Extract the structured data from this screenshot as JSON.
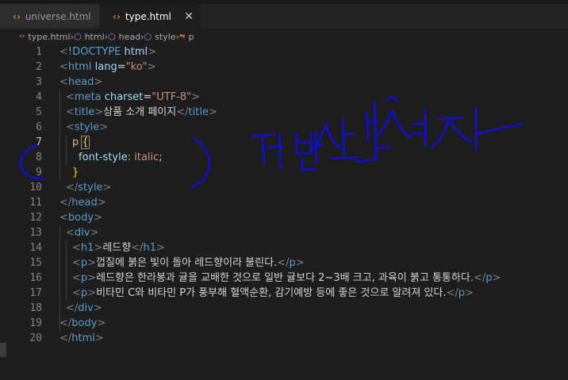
{
  "tabs": [
    {
      "label": "universe.html",
      "active": false
    },
    {
      "label": "type.html",
      "active": true
    }
  ],
  "breadcrumb": [
    "type.html",
    "html",
    "head",
    "style",
    "p"
  ],
  "lines": [
    {
      "n": "1",
      "tokens": [
        [
          "t-punct",
          "<"
        ],
        [
          "t-tag",
          "!DOCTYPE"
        ],
        [
          "t-text",
          " "
        ],
        [
          "t-attr",
          "html"
        ],
        [
          "t-punct",
          ">"
        ]
      ],
      "indent": 0
    },
    {
      "n": "2",
      "tokens": [
        [
          "t-punct",
          "<"
        ],
        [
          "t-tag",
          "html"
        ],
        [
          "t-text",
          " "
        ],
        [
          "t-attr",
          "lang"
        ],
        [
          "t-text",
          "="
        ],
        [
          "t-str",
          "\"ko\""
        ],
        [
          "t-punct",
          ">"
        ]
      ],
      "indent": 0
    },
    {
      "n": "3",
      "tokens": [
        [
          "t-punct",
          "<"
        ],
        [
          "t-tag",
          "head"
        ],
        [
          "t-punct",
          ">"
        ]
      ],
      "indent": 0
    },
    {
      "n": "4",
      "tokens": [
        [
          "t-punct",
          "<"
        ],
        [
          "t-tag",
          "meta"
        ],
        [
          "t-text",
          " "
        ],
        [
          "t-attr",
          "charset"
        ],
        [
          "t-text",
          "="
        ],
        [
          "t-str",
          "\"UTF-8\""
        ],
        [
          "t-punct",
          ">"
        ]
      ],
      "indent": 1
    },
    {
      "n": "5",
      "tokens": [
        [
          "t-punct",
          "<"
        ],
        [
          "t-tag",
          "title"
        ],
        [
          "t-punct",
          ">"
        ],
        [
          "t-text",
          "상품 소개 페이지"
        ],
        [
          "t-punct",
          "</"
        ],
        [
          "t-tag",
          "title"
        ],
        [
          "t-punct",
          ">"
        ]
      ],
      "indent": 1
    },
    {
      "n": "6",
      "tokens": [
        [
          "t-punct",
          "<"
        ],
        [
          "t-tag",
          "style"
        ],
        [
          "t-punct",
          ">"
        ]
      ],
      "indent": 1
    },
    {
      "n": "7",
      "tokens": [
        [
          "t-sel",
          "p"
        ],
        [
          "t-text",
          " "
        ],
        [
          "t-brace",
          "{"
        ]
      ],
      "indent": 2
    },
    {
      "n": "8",
      "tokens": [
        [
          "t-prop",
          "font-style"
        ],
        [
          "t-text",
          ": "
        ],
        [
          "t-val",
          "italic"
        ],
        [
          "t-text",
          ";"
        ]
      ],
      "indent": 3
    },
    {
      "n": "9",
      "tokens": [
        [
          "t-brace",
          "}"
        ]
      ],
      "indent": 2
    },
    {
      "n": "10",
      "tokens": [
        [
          "t-punct",
          "</"
        ],
        [
          "t-tag",
          "style"
        ],
        [
          "t-punct",
          ">"
        ]
      ],
      "indent": 1
    },
    {
      "n": "11",
      "tokens": [
        [
          "t-punct",
          "</"
        ],
        [
          "t-tag",
          "head"
        ],
        [
          "t-punct",
          ">"
        ]
      ],
      "indent": 0
    },
    {
      "n": "12",
      "tokens": [
        [
          "t-punct",
          "<"
        ],
        [
          "t-tag",
          "body"
        ],
        [
          "t-punct",
          ">"
        ]
      ],
      "indent": 0
    },
    {
      "n": "13",
      "tokens": [
        [
          "t-punct",
          "<"
        ],
        [
          "t-tag",
          "div"
        ],
        [
          "t-punct",
          ">"
        ]
      ],
      "indent": 1
    },
    {
      "n": "14",
      "tokens": [
        [
          "t-punct",
          "<"
        ],
        [
          "t-tag",
          "h1"
        ],
        [
          "t-punct",
          ">"
        ],
        [
          "t-text",
          "레드향"
        ],
        [
          "t-punct",
          "</"
        ],
        [
          "t-tag",
          "h1"
        ],
        [
          "t-punct",
          ">"
        ]
      ],
      "indent": 2
    },
    {
      "n": "15",
      "tokens": [
        [
          "t-punct",
          "<"
        ],
        [
          "t-tag",
          "p"
        ],
        [
          "t-punct",
          ">"
        ],
        [
          "t-text",
          "껍질에 붉은 빛이 돌아 레드향이라 불린다."
        ],
        [
          "t-punct",
          "</"
        ],
        [
          "t-tag",
          "p"
        ],
        [
          "t-punct",
          ">"
        ]
      ],
      "indent": 2
    },
    {
      "n": "16",
      "tokens": [
        [
          "t-punct",
          "<"
        ],
        [
          "t-tag",
          "p"
        ],
        [
          "t-punct",
          ">"
        ],
        [
          "t-text",
          "레드향은 한라봉과 귤을 교배한 것으로 일반 귤보다 2~3배 크고, 과육이 붉고 통통하다."
        ],
        [
          "t-punct",
          "</"
        ],
        [
          "t-tag",
          "p"
        ],
        [
          "t-punct",
          ">"
        ]
      ],
      "indent": 2
    },
    {
      "n": "17",
      "tokens": [
        [
          "t-punct",
          "<"
        ],
        [
          "t-tag",
          "p"
        ],
        [
          "t-punct",
          ">"
        ],
        [
          "t-text",
          "비타민 C와 비타민 P가 풍부해 혈액순환, 감기예방 등에 좋은 것으로 알려져 있다."
        ],
        [
          "t-punct",
          "</"
        ],
        [
          "t-tag",
          "p"
        ],
        [
          "t-punct",
          ">"
        ]
      ],
      "indent": 2
    },
    {
      "n": "18",
      "tokens": [
        [
          "t-punct",
          "</"
        ],
        [
          "t-tag",
          "div"
        ],
        [
          "t-punct",
          ">"
        ]
      ],
      "indent": 1
    },
    {
      "n": "19",
      "tokens": [
        [
          "t-punct",
          "</"
        ],
        [
          "t-tag",
          "body"
        ],
        [
          "t-punct",
          ">"
        ]
      ],
      "indent": 0
    },
    {
      "n": "20",
      "tokens": [
        [
          "t-punct",
          "</"
        ],
        [
          "t-tag",
          "html"
        ],
        [
          "t-punct",
          ">"
        ]
      ],
      "indent": 0
    }
  ],
  "current_line": "7",
  "colors": {
    "ink": "#1010d8",
    "accent_html": "#e37933"
  }
}
